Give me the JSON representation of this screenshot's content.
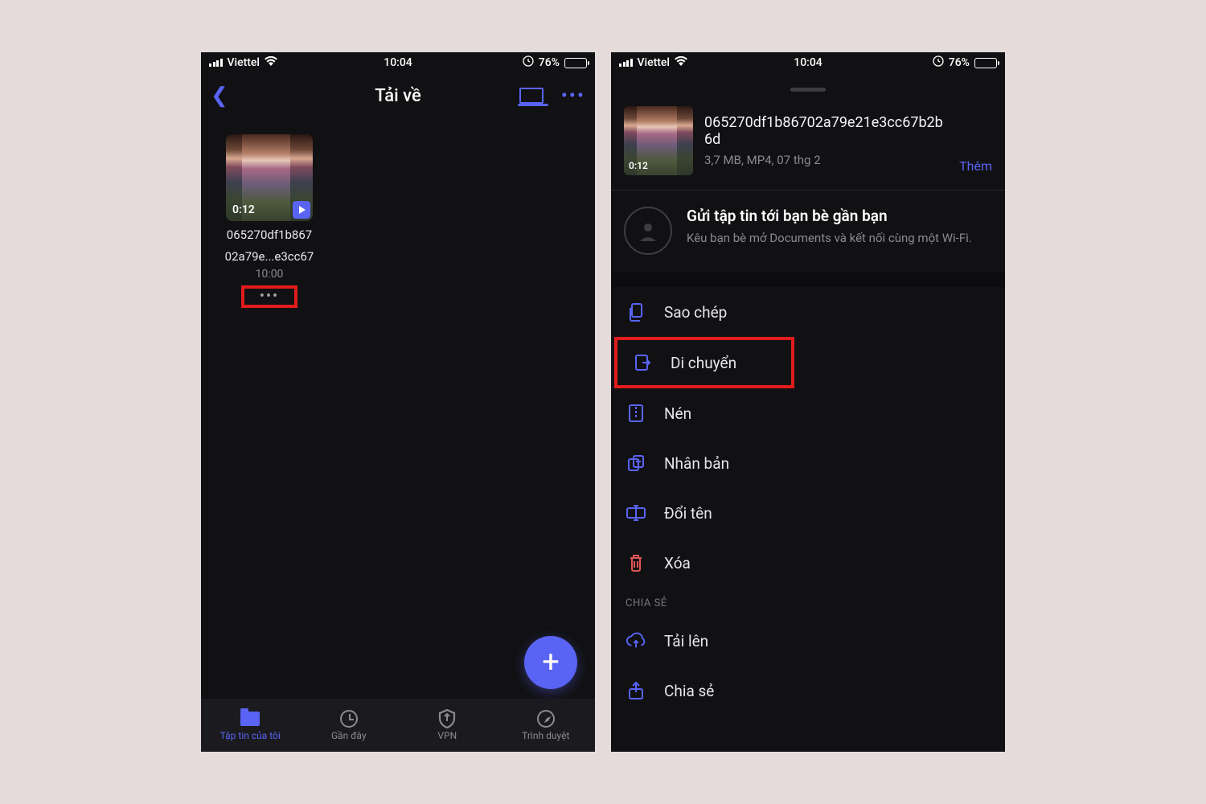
{
  "statusbar": {
    "carrier": "Viettel",
    "time": "10:04",
    "battery_pct": "76%"
  },
  "left": {
    "title": "Tải về",
    "file": {
      "duration": "0:12",
      "name_l1": "065270df1b867",
      "name_l2": "02a79e...e3cc67",
      "modified": "10:00"
    },
    "tabs": {
      "files": "Tập tin của tôi",
      "recent": "Gần đây",
      "vpn": "VPN",
      "browser": "Trình duyệt"
    }
  },
  "right": {
    "file": {
      "name": "065270df1b86702a79e21e3cc67b2b6d",
      "meta": "3,7 MB, MP4, 07 thg 2",
      "duration": "0:12",
      "more": "Thêm"
    },
    "share": {
      "title": "Gửi tập tin tới bạn bè gần bạn",
      "sub": "Kêu bạn bè mở Documents và kết nối cùng một Wi-Fi."
    },
    "actions": {
      "copy": "Sao chép",
      "move": "Di chuyển",
      "compress": "Nén",
      "duplicate": "Nhân bản",
      "rename": "Đổi tên",
      "delete": "Xóa"
    },
    "share_section": "CHIA SẺ",
    "share_actions": {
      "upload": "Tải lên",
      "share": "Chia sẻ"
    }
  }
}
